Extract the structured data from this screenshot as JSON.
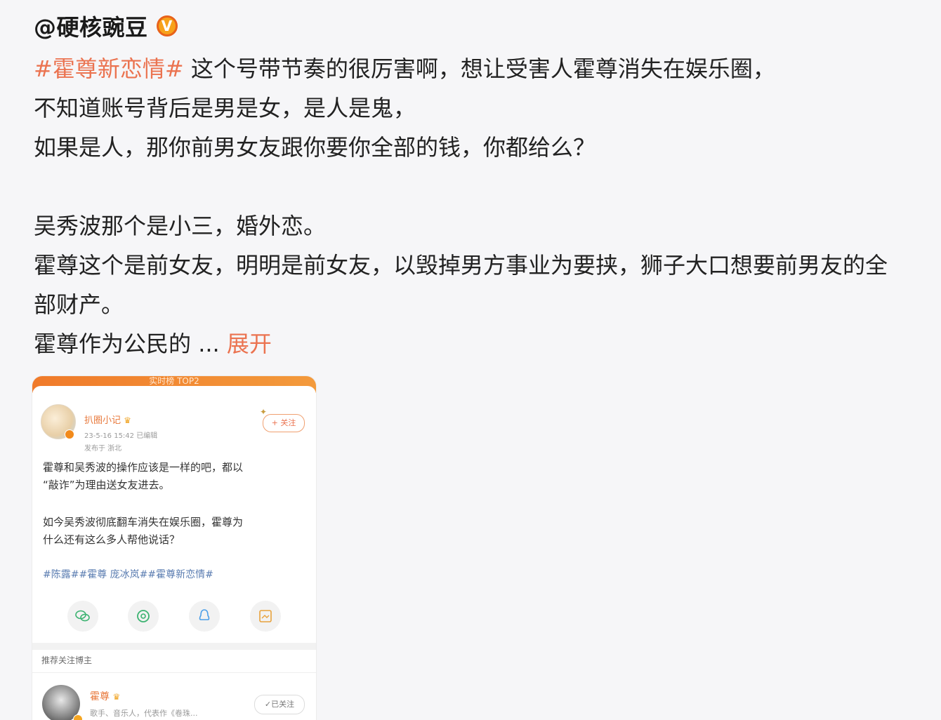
{
  "post": {
    "author": "@硬核豌豆",
    "verified_badge": "V",
    "hashtag": "#霍尊新恋情#",
    "line1_rest": " 这个号带节奏的很厉害啊，想让受害人霍尊消失在娱乐圈，",
    "line2": "不知道账号背后是男是女，是人是鬼，",
    "line3": "如果是人，那你前男女友跟你要你全部的钱，你都给么？",
    "line5": "吴秀波那个是小三，婚外恋。",
    "line6": "霍尊这个是前女友，明明是前女友，以毁掉男方事业为要挟，狮子大口想要前男友的全",
    "line7": "部财产。",
    "line8": "霍尊作为公民的",
    "ellipsis": " ... ",
    "expand_label": "展开"
  },
  "embedded": {
    "top_bar": "实时榜 TOP2",
    "author_name": "扒圈小记",
    "time": "23-5-16 15:42  已编辑",
    "location": "发布于 浙北",
    "follow_label": "+ 关注",
    "para1_line1": "霍尊和吴秀波的操作应该是一样的吧，都以",
    "para1_line2": "“敲诈”为理由送女友进去。",
    "para2_line1": "如今吴秀波彻底翻车消失在娱乐圈，霍尊为",
    "para2_line2": "什么还有这么多人帮他说话？",
    "tags": "#陈露##霍尊 庞冰岚##霍尊新恋情#",
    "share_icons": [
      "wechat-icon",
      "moments-icon",
      "qq-icon",
      "save-image-icon"
    ],
    "recommend_title": "推荐关注博主",
    "rec_name": "霍尊",
    "rec_desc": "歌手、音乐人，代表作《卷珠...",
    "rec_followed": "✓已关注"
  },
  "colors": {
    "accent": "#eb7350",
    "badge": "#f7a21b",
    "background": "#f6f6f8"
  }
}
